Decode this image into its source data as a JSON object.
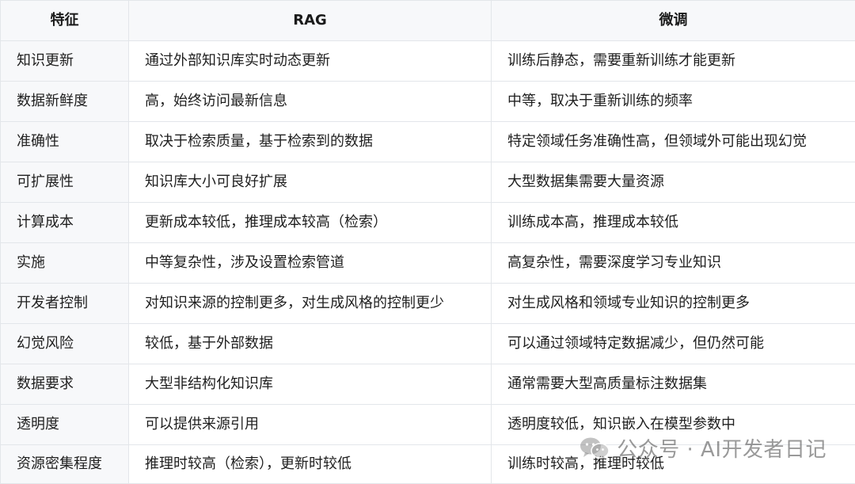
{
  "table": {
    "headers": [
      "特征",
      "RAG",
      "微调"
    ],
    "rows": [
      {
        "feature": "知识更新",
        "rag": "通过外部知识库实时动态更新",
        "finetune": "训练后静态，需要重新训练才能更新"
      },
      {
        "feature": "数据新鲜度",
        "rag": "高，始终访问最新信息",
        "finetune": "中等，取决于重新训练的频率"
      },
      {
        "feature": "准确性",
        "rag": "取决于检索质量，基于检索到的数据",
        "finetune": "特定领域任务准确性高，但领域外可能出现幻觉"
      },
      {
        "feature": "可扩展性",
        "rag": "知识库大小可良好扩展",
        "finetune": "大型数据集需要大量资源"
      },
      {
        "feature": "计算成本",
        "rag": "更新成本较低，推理成本较高（检索）",
        "finetune": "训练成本高，推理成本较低"
      },
      {
        "feature": "实施",
        "rag": "中等复杂性，涉及设置检索管道",
        "finetune": "高复杂性，需要深度学习专业知识"
      },
      {
        "feature": "开发者控制",
        "rag": "对知识来源的控制更多，对生成风格的控制更少",
        "finetune": "对生成风格和领域专业知识的控制更多"
      },
      {
        "feature": "幻觉风险",
        "rag": "较低，基于外部数据",
        "finetune": "可以通过领域特定数据减少，但仍然可能"
      },
      {
        "feature": "数据要求",
        "rag": "大型非结构化知识库",
        "finetune": "通常需要大型高质量标注数据集"
      },
      {
        "feature": "透明度",
        "rag": "可以提供来源引用",
        "finetune": "透明度较低，知识嵌入在模型参数中"
      },
      {
        "feature": "资源密集程度",
        "rag": "推理时较高（检索），更新时较低",
        "finetune": "训练时较高，推理时较低"
      }
    ]
  },
  "watermark": {
    "text": "公众号 · AI开发者日记",
    "icon": "wechat-icon"
  }
}
